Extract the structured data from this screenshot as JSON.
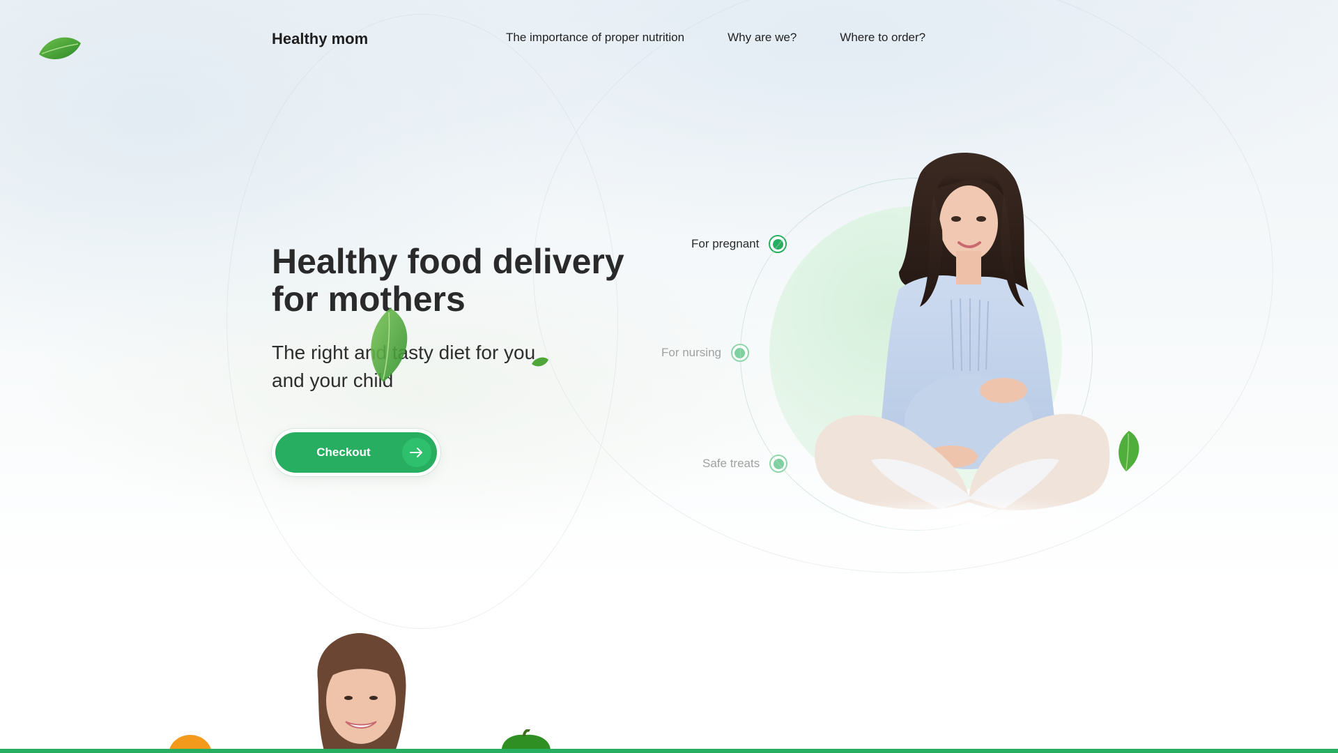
{
  "header": {
    "brand": "Healthy mom",
    "nav": [
      {
        "label": "The importance of proper nutrition"
      },
      {
        "label": "Why are we?"
      },
      {
        "label": "Where to order?"
      }
    ]
  },
  "hero": {
    "title": "Healthy food delivery for mothers",
    "subtitle": "The right and tasty diet for you and your child",
    "cta_label": "Checkout"
  },
  "categories": [
    {
      "label": "For pregnant",
      "active": true
    },
    {
      "label": "For nursing",
      "active": false
    },
    {
      "label": "Safe treats",
      "active": false
    }
  ],
  "colors": {
    "accent": "#27ae60",
    "accent_light": "#7fd0a0",
    "text": "#2a2a2a",
    "muted": "#9a9a9a"
  },
  "icons": [
    "leaf-icon",
    "arrow-right-icon"
  ]
}
